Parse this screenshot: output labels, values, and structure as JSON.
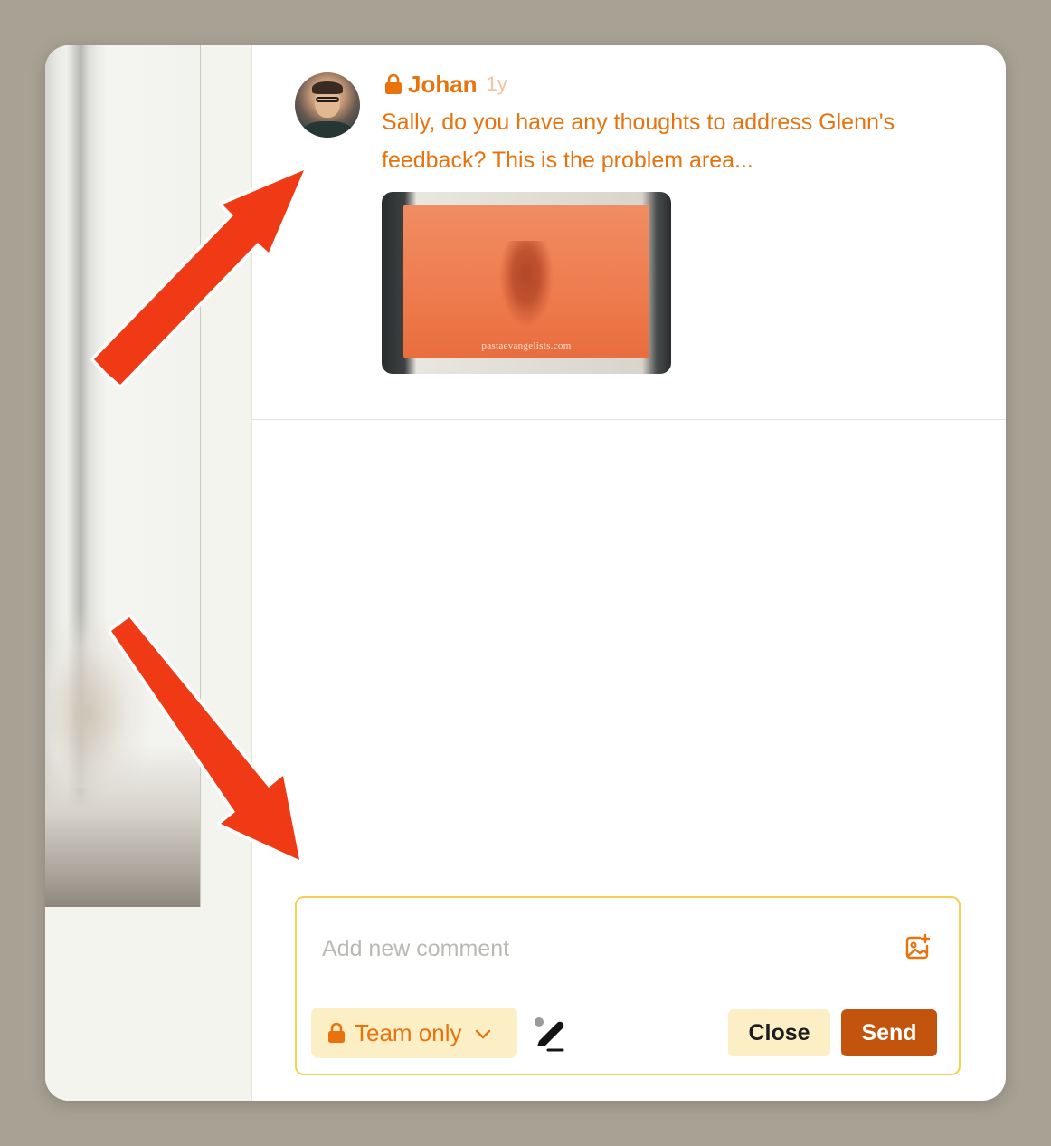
{
  "comment": {
    "author": "Johan",
    "time": "1y",
    "body": "Sally, do you have any thoughts to address Glenn's feedback? This is the problem area...",
    "attachment": {
      "box_text": "pastaevangelists.com"
    }
  },
  "composer": {
    "placeholder": "Add new comment",
    "visibility": "Team only",
    "close_label": "Close",
    "send_label": "Send"
  },
  "icons": [
    "lock-icon",
    "chevron-down-icon",
    "add-image-icon",
    "pen-icon",
    "arrow-icon"
  ],
  "colors": {
    "accent": "#e8720c",
    "send": "#c2540e",
    "highlight": "#fcefc6",
    "composer_border": "#f6cf57",
    "arrow": "#f03a16",
    "background": "#a8a294"
  }
}
